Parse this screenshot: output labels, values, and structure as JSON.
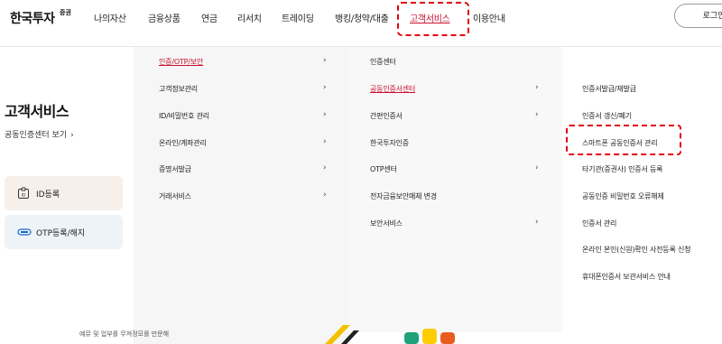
{
  "header": {
    "logo_main": "한국투자",
    "logo_sub": "증권",
    "nav": [
      "나의자산",
      "금융상품",
      "연금",
      "리서치",
      "트레이딩",
      "뱅킹/청약/대출",
      "고객서비스",
      "이용안내"
    ],
    "active_nav_index": 6,
    "login_label": "로그인"
  },
  "left": {
    "title": "고객서비스",
    "link": "공동인증센터 보기",
    "quick": [
      "ID등록",
      "OTP등록/해지"
    ]
  },
  "menu": {
    "col1": [
      "인증/OTP/보안",
      "고객정보관리",
      "ID/비밀번호 관리",
      "온라인/계좌관리",
      "증명서발급",
      "거래서비스"
    ],
    "col2": [
      "인증센터",
      "공동인증서센터",
      "간편인증서",
      "한국투자인증",
      "OTP센터",
      "전자금융보안매체 변경",
      "보안서비스"
    ],
    "col3": [
      "인증서발급/재발급",
      "인증서 갱신/폐기",
      "스마트폰 공동인증서 관리",
      "타기관(증권사) 인증서 등록",
      "공동인증 비밀번호 오류해제",
      "인증서 관리",
      "온라인 본인(신원)확인 사전등록 신청",
      "휴대폰인증서 보관서비스 안내"
    ]
  },
  "bottom": {
    "text": "예뮤 및 업부를 무져정모를 만문해"
  },
  "colors": {
    "accent": "#c8102e",
    "highlight": "#e3000f"
  }
}
